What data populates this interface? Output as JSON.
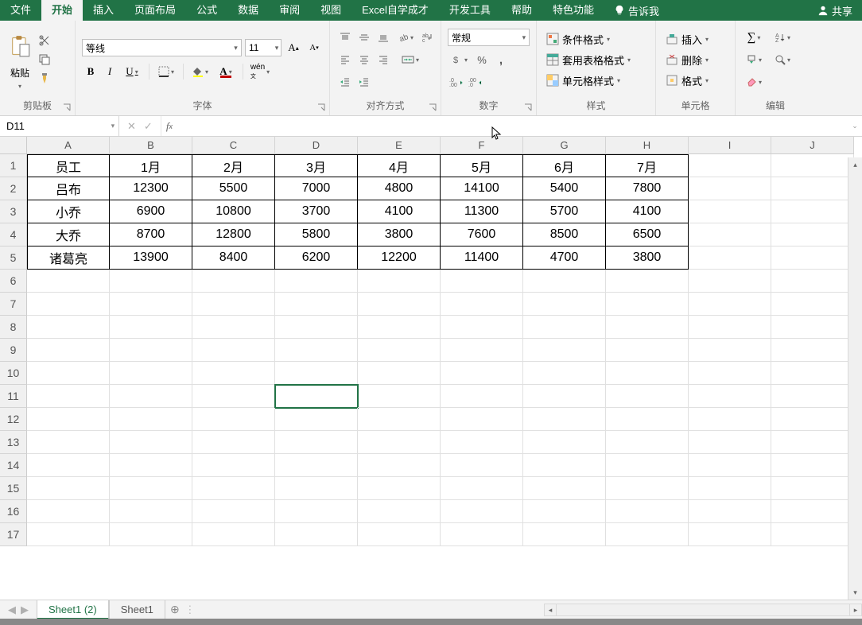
{
  "tabs": {
    "file": "文件",
    "home": "开始",
    "insert": "插入",
    "layout": "页面布局",
    "formula": "公式",
    "data": "数据",
    "review": "审阅",
    "view": "视图",
    "custom1": "Excel自学成才",
    "dev": "开发工具",
    "help": "帮助",
    "custom2": "特色功能",
    "tell": "告诉我",
    "share": "共享"
  },
  "ribbon": {
    "clipboard": {
      "paste": "粘贴",
      "label": "剪贴板"
    },
    "font": {
      "name": "等线",
      "size": "11",
      "label": "字体"
    },
    "align": {
      "label": "对齐方式"
    },
    "number": {
      "format": "常规",
      "label": "数字"
    },
    "styles": {
      "cond": "条件格式",
      "table": "套用表格格式",
      "cell": "单元格样式",
      "label": "样式"
    },
    "cells": {
      "insert": "插入",
      "delete": "删除",
      "format": "格式",
      "label": "单元格"
    },
    "edit": {
      "label": "编辑"
    }
  },
  "namebox": "D11",
  "formula": "",
  "columns": [
    "A",
    "B",
    "C",
    "D",
    "E",
    "F",
    "G",
    "H",
    "I",
    "J"
  ],
  "row_numbers": [
    "1",
    "2",
    "3",
    "4",
    "5",
    "6",
    "7",
    "8",
    "9",
    "10",
    "11",
    "12",
    "13",
    "14",
    "15",
    "16",
    "17"
  ],
  "table": {
    "headers": [
      "员工",
      "1月",
      "2月",
      "3月",
      "4月",
      "5月",
      "6月",
      "7月"
    ],
    "rows": [
      [
        "吕布",
        "12300",
        "5500",
        "7000",
        "4800",
        "14100",
        "5400",
        "7800"
      ],
      [
        "小乔",
        "6900",
        "10800",
        "3700",
        "4100",
        "11300",
        "5700",
        "4100"
      ],
      [
        "大乔",
        "8700",
        "12800",
        "5800",
        "3800",
        "7600",
        "8500",
        "6500"
      ],
      [
        "诸葛亮",
        "13900",
        "8400",
        "6200",
        "12200",
        "11400",
        "4700",
        "3800"
      ]
    ]
  },
  "active_cell": {
    "row": 10,
    "col": 3
  },
  "sheets": {
    "s1": "Sheet1 (2)",
    "s2": "Sheet1"
  }
}
